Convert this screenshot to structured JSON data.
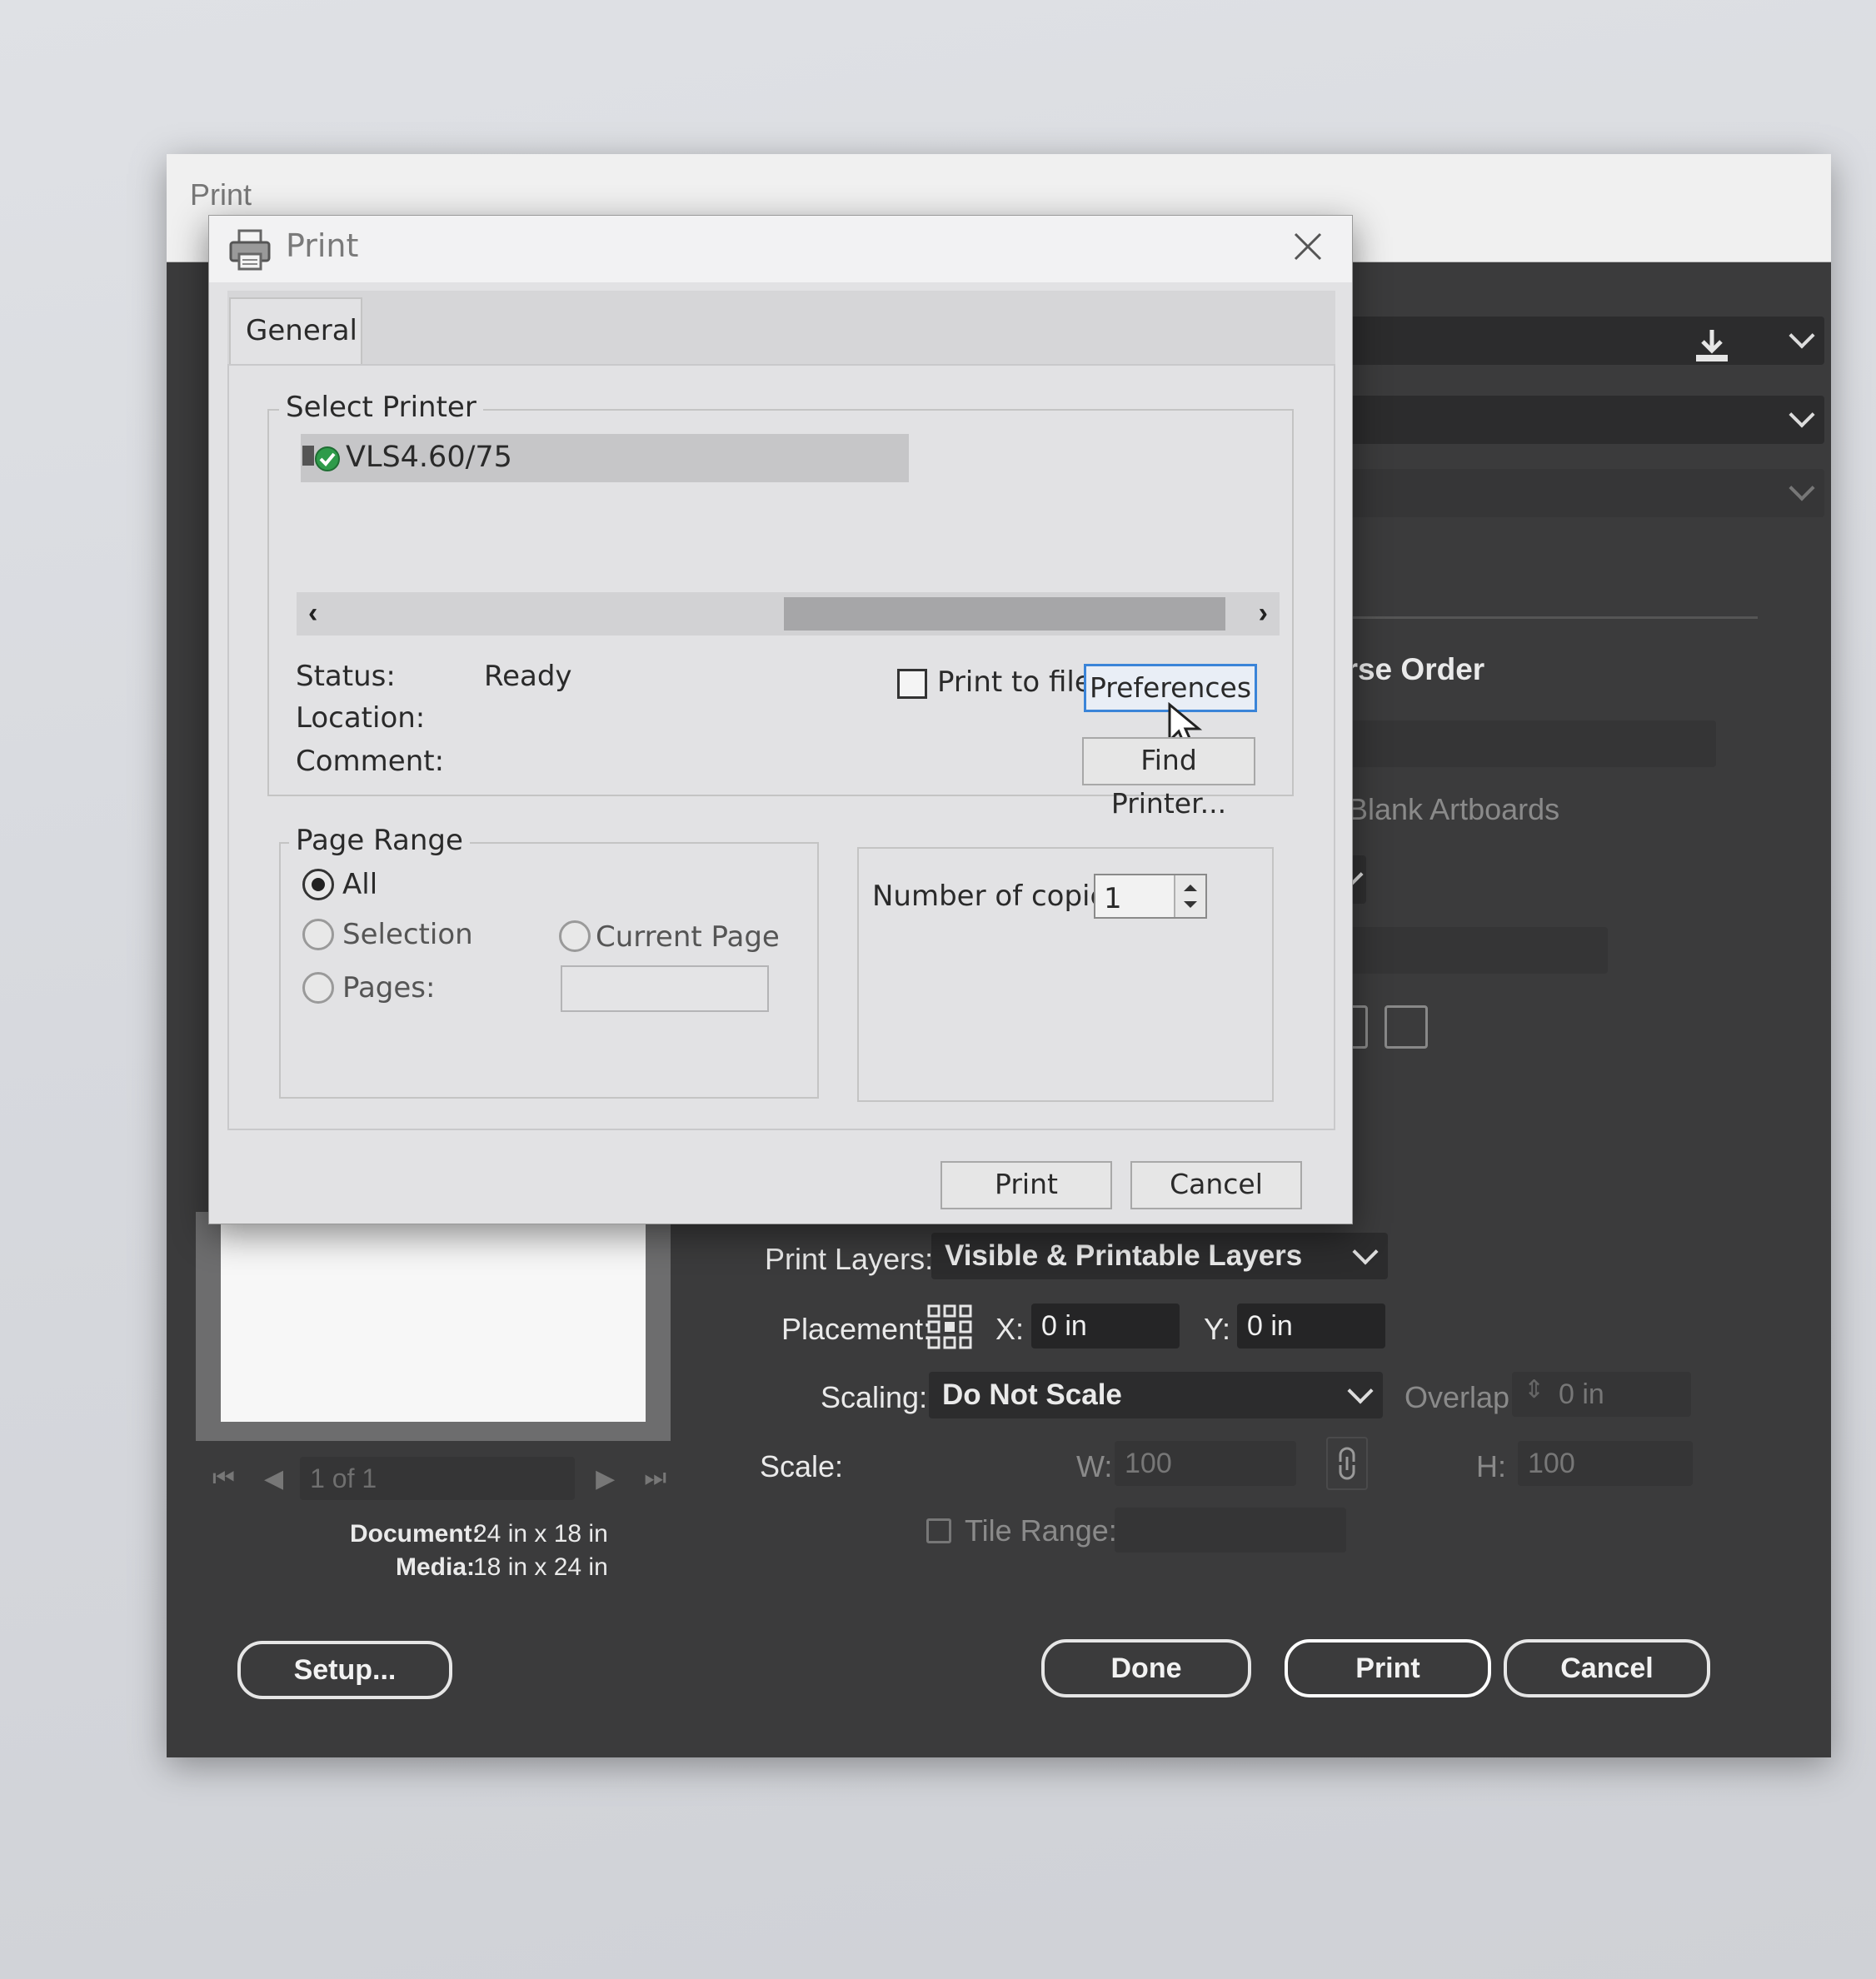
{
  "background_dialog": {
    "title": "Print",
    "partial_reverse_order": "erse Order",
    "partial_blank_artboards": "Blank Artboards",
    "preview": {
      "nav_counter": "1 of 1",
      "document_label": "Document:",
      "document_value": "24 in x 18 in",
      "media_label": "Media:",
      "media_value": "18 in x 24 in"
    },
    "options": {
      "print_layers_label": "Print Layers:",
      "print_layers_value": "Visible & Printable Layers",
      "placement_label": "Placement:",
      "x_label": "X:",
      "x_value": "0 in",
      "y_label": "Y:",
      "y_value": "0 in",
      "scaling_label": "Scaling:",
      "scaling_value": "Do Not Scale",
      "overlap_label": "Overlap:",
      "overlap_value": "0 in",
      "scale_label": "Scale:",
      "w_label": "W:",
      "w_value": "100",
      "h_label": "H:",
      "h_value": "100",
      "tile_range_label": "Tile Range:"
    },
    "buttons": {
      "setup": "Setup...",
      "done": "Done",
      "print": "Print",
      "cancel": "Cancel"
    }
  },
  "print_dialog": {
    "title": "Print",
    "tabs": [
      "General"
    ],
    "select_printer_label": "Select Printer",
    "printers": [
      {
        "name": "VLS4.60/75",
        "selected": true,
        "status_icon": "green-check-icon"
      }
    ],
    "status_label": "Status:",
    "status_value": "Ready",
    "location_label": "Location:",
    "location_value": "",
    "comment_label": "Comment:",
    "comment_value": "",
    "print_to_file_label": "Print to file",
    "print_to_file_checked": false,
    "preferences_button": "Preferences",
    "find_printer_button": "Find Printer...",
    "page_range": {
      "label": "Page Range",
      "all": "All",
      "selection": "Selection",
      "current_page": "Current Page",
      "pages": "Pages:",
      "selected": "All",
      "pages_value": ""
    },
    "copies_label": "Number of copies:",
    "copies_value": "1",
    "print_button": "Print",
    "cancel_button": "Cancel"
  },
  "colors": {
    "background_dialog": "#3b3b3c",
    "dialog_face": "#e2e2e4",
    "selection_highlight": "#c6c6c8",
    "focus_border": "#3a84d8",
    "status_green": "#2e9b4a"
  }
}
